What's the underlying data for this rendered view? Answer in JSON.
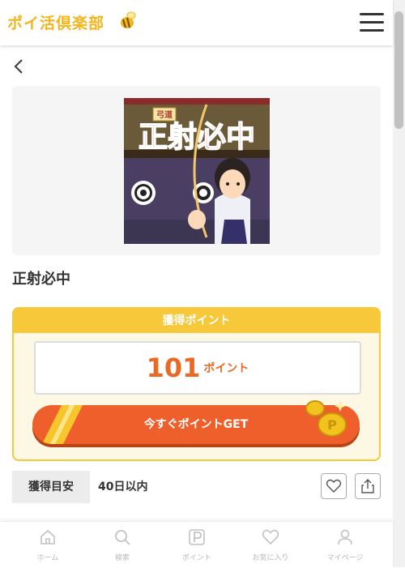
{
  "header": {
    "logo_text": "ポイ活倶楽部"
  },
  "offer": {
    "title": "正射必中",
    "thumbnail": {
      "banner_text": "正射必中",
      "tag_text": "弓道"
    }
  },
  "points": {
    "header_label": "獲得ポイント",
    "value": "101",
    "unit": "ポイント",
    "get_button_label": "今すぐポイントGET"
  },
  "meta": {
    "label": "獲得目安",
    "value": "40日以内"
  },
  "bottom_nav": {
    "items": [
      {
        "label": "ホーム",
        "icon": "home-icon"
      },
      {
        "label": "検索",
        "icon": "search-icon"
      },
      {
        "label": "ポイント",
        "icon": "point-icon"
      },
      {
        "label": "お気に入り",
        "icon": "heart-icon"
      },
      {
        "label": "マイページ",
        "icon": "user-icon"
      }
    ]
  },
  "colors": {
    "brand_yellow": "#f6c83a",
    "accent_orange": "#ef5f2c",
    "points_text": "#ea6a25"
  }
}
